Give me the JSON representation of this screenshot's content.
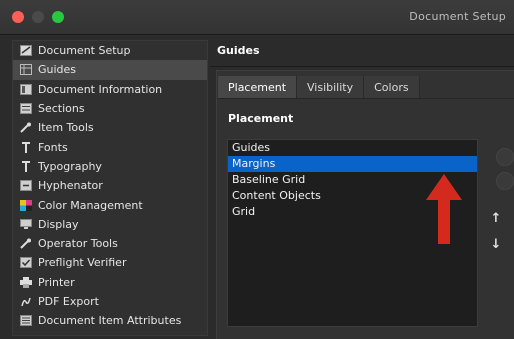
{
  "window": {
    "title": "Document Setup"
  },
  "sidebar": {
    "items": [
      {
        "label": "Document Setup",
        "icon": "document-setup-icon",
        "selected": false
      },
      {
        "label": "Guides",
        "icon": "guides-icon",
        "selected": true
      },
      {
        "label": "Document Information",
        "icon": "document-information-icon",
        "selected": false
      },
      {
        "label": "Sections",
        "icon": "sections-icon",
        "selected": false
      },
      {
        "label": "Item Tools",
        "icon": "item-tools-icon",
        "selected": false
      },
      {
        "label": "Fonts",
        "icon": "fonts-icon",
        "selected": false
      },
      {
        "label": "Typography",
        "icon": "typography-icon",
        "selected": false
      },
      {
        "label": "Hyphenator",
        "icon": "hyphenator-icon",
        "selected": false
      },
      {
        "label": "Color Management",
        "icon": "color-management-icon",
        "selected": false
      },
      {
        "label": "Display",
        "icon": "display-icon",
        "selected": false
      },
      {
        "label": "Operator Tools",
        "icon": "operator-tools-icon",
        "selected": false
      },
      {
        "label": "Preflight Verifier",
        "icon": "preflight-verifier-icon",
        "selected": false
      },
      {
        "label": "Printer",
        "icon": "printer-icon",
        "selected": false
      },
      {
        "label": "PDF Export",
        "icon": "pdf-export-icon",
        "selected": false
      },
      {
        "label": "Document Item Attributes",
        "icon": "document-item-attributes-icon",
        "selected": false
      }
    ]
  },
  "main": {
    "title": "Guides",
    "tabs": [
      {
        "label": "Placement",
        "active": true
      },
      {
        "label": "Visibility",
        "active": false
      },
      {
        "label": "Colors",
        "active": false
      }
    ],
    "section_label": "Placement",
    "list": {
      "items": [
        {
          "label": "Guides",
          "selected": false
        },
        {
          "label": "Margins",
          "selected": true
        },
        {
          "label": "Baseline Grid",
          "selected": false
        },
        {
          "label": "Content Objects",
          "selected": false
        },
        {
          "label": "Grid",
          "selected": false
        }
      ]
    },
    "buttons": {
      "move_up": "↑",
      "move_down": "↓"
    }
  },
  "colors": {
    "selection": "#0a63c8",
    "annotation": "#d42a1e"
  }
}
